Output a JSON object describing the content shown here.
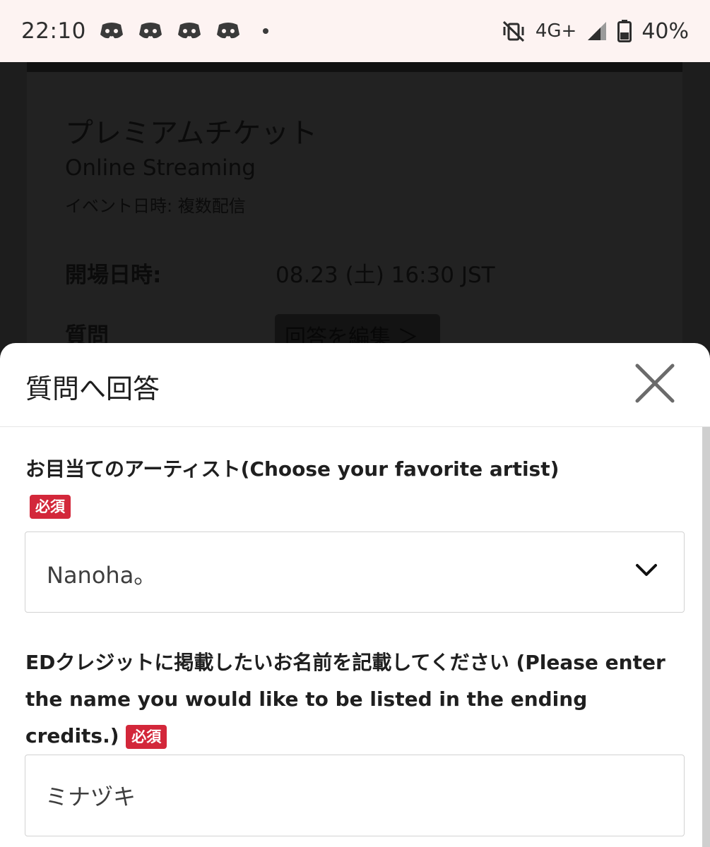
{
  "status_bar": {
    "time": "22:10",
    "notification_icons": [
      "discord-icon",
      "discord-icon",
      "discord-icon",
      "discord-icon"
    ],
    "network": "4G+",
    "battery": "40%"
  },
  "background_page": {
    "title": "プレミアムチケット",
    "subtitle": "Online Streaming",
    "event_datetime": "イベント日時: 複数配信",
    "open_label": "開場日時:",
    "open_value": "08.23 (土) 16:30 JST",
    "question_label": "質問",
    "edit_answers_button": "回答を編集 ＞"
  },
  "sheet": {
    "title": "質問へ回答",
    "questions": [
      {
        "label": "お目当てのアーティスト(Choose your favorite artist)",
        "required_badge": "必須",
        "selected_value": "Nanoha。"
      },
      {
        "label": "EDクレジットに掲載したいお名前を記載してください (Please enter the name you would like to be listed in the ending credits.)",
        "required_badge": "必須",
        "input_value": "ミナヅキ"
      }
    ]
  },
  "colors": {
    "required_badge": "#d3273a",
    "status_bar_bg": "#fdf3f2",
    "overlay_bg": "#1c1c1c"
  }
}
